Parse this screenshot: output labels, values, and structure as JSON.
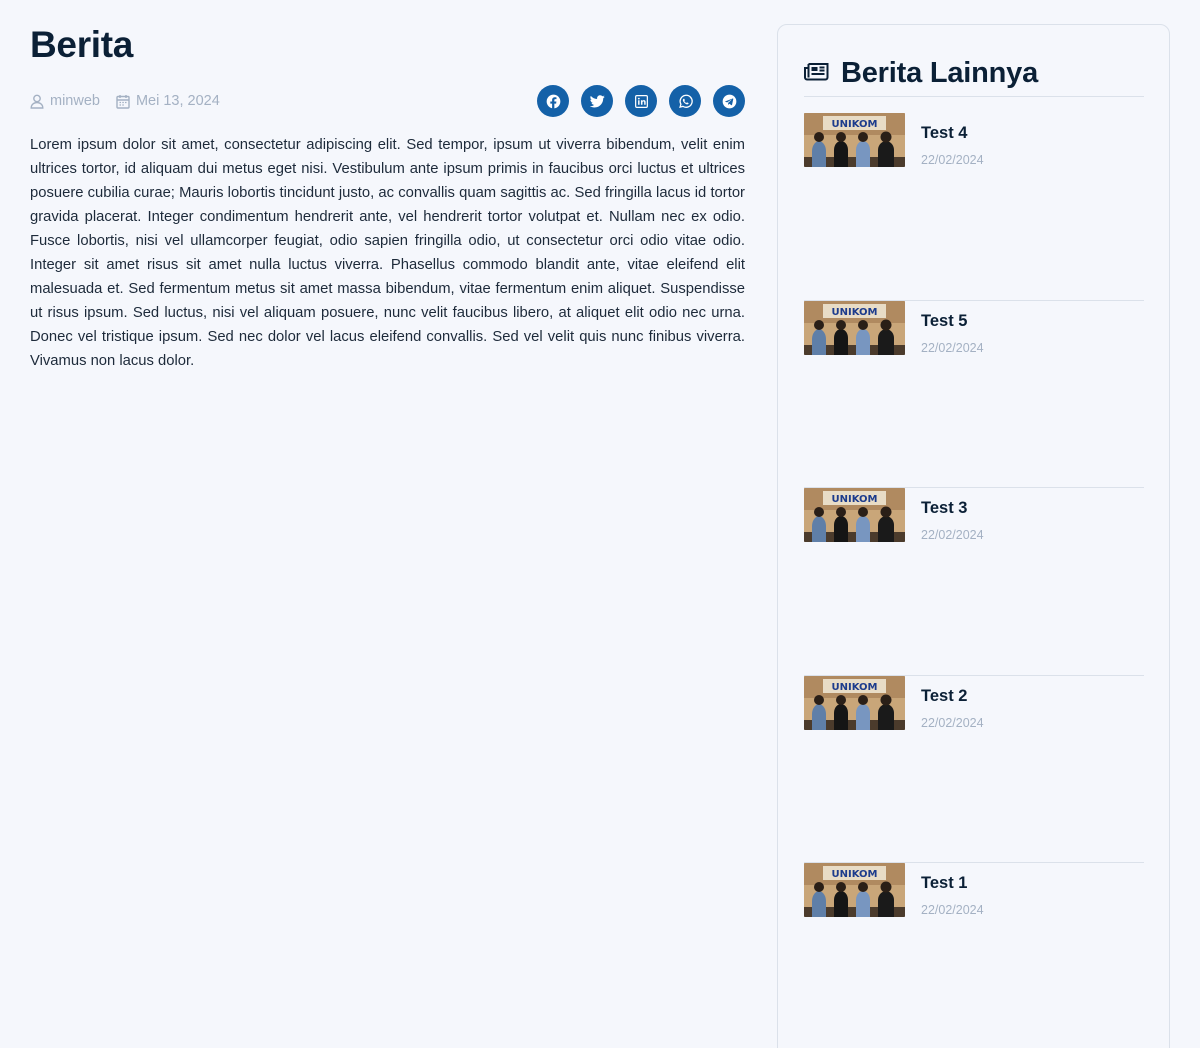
{
  "article": {
    "title": "Berita",
    "author": "minweb",
    "date": "Mei 13, 2024",
    "body": "Lorem ipsum dolor sit amet, consectetur adipiscing elit. Sed tempor, ipsum ut viverra bibendum, velit enim ultrices tortor, id aliquam dui metus eget nisi. Vestibulum ante ipsum primis in faucibus orci luctus et ultrices posuere cubilia curae; Mauris lobortis tincidunt justo, ac convallis quam sagittis ac. Sed fringilla lacus id tortor gravida placerat. Integer condimentum hendrerit ante, vel hendrerit tortor volutpat et. Nullam nec ex odio. Fusce lobortis, nisi vel ullamcorper feugiat, odio sapien fringilla odio, ut consectetur orci odio vitae odio. Integer sit amet risus sit amet nulla luctus viverra. Phasellus commodo blandit ante, vitae eleifend elit malesuada et. Sed fermentum metus sit amet massa bibendum, vitae fermentum enim aliquet. Suspendisse ut risus ipsum. Sed luctus, nisi vel aliquam posuere, nunc velit faucibus libero, at aliquet elit odio nec urna. Donec vel tristique ipsum. Sed nec dolor vel lacus eleifend convallis. Sed vel velit quis nunc finibus viverra. Vivamus non lacus dolor."
  },
  "share": {
    "icons": [
      "facebook-icon",
      "twitter-icon",
      "linkedin-icon",
      "whatsapp-icon",
      "telegram-icon"
    ],
    "color": "#1461a8"
  },
  "sidebar": {
    "title": "Berita Lainnya",
    "items": [
      {
        "title": "Test 4",
        "date": "22/02/2024",
        "image_text": "UNIKOM"
      },
      {
        "title": "Test 5",
        "date": "22/02/2024",
        "image_text": "UNIKOM"
      },
      {
        "title": "Test 3",
        "date": "22/02/2024",
        "image_text": "UNIKOM"
      },
      {
        "title": "Test 2",
        "date": "22/02/2024",
        "image_text": "UNIKOM"
      },
      {
        "title": "Test 1",
        "date": "22/02/2024",
        "image_text": "UNIKOM"
      }
    ]
  },
  "colors": {
    "background": "#f5f7fc",
    "heading": "#0b2036",
    "muted": "#a4b1c3",
    "accent": "#1461a8"
  }
}
